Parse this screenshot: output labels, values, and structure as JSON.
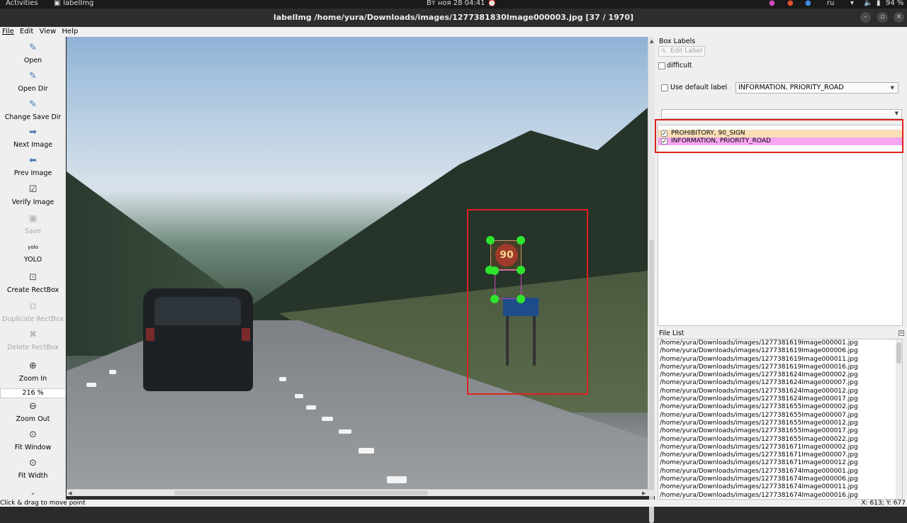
{
  "topbar": {
    "activities": "Activities",
    "app_name": "labelImg",
    "clock": "Вт ноя 28  04:41",
    "lang": "ru",
    "battery": "94 %"
  },
  "window": {
    "title": "labelImg /home/yura/Downloads/images/1277381830Image000003.jpg [37 / 1970]",
    "minimize": "–",
    "maximize": "▫",
    "close": "×"
  },
  "menu": [
    "File",
    "Edit",
    "View",
    "Help"
  ],
  "toolbar": {
    "open": "Open",
    "open_dir": "Open Dir",
    "change_save_dir": "Change Save Dir",
    "next_image": "Next Image",
    "prev_image": "Prev Image",
    "verify_image": "Verify Image",
    "save": "Save",
    "yolo_icon": "yolo",
    "yolo": "YOLO",
    "create_rectbox": "Create RectBox",
    "duplicate_rectbox": "Duplicate RectBox",
    "delete_rectbox": "Delete RectBox",
    "zoom_in": "Zoom In",
    "zoom_value": "216 %",
    "zoom_out": "Zoom Out",
    "fit_window": "Fit Window",
    "fit_width": "Fit Width"
  },
  "canvas": {
    "speed_sign_text": "90"
  },
  "right_panel": {
    "box_labels_title": "Box Labels",
    "edit_label": "Edit Label",
    "difficult": "difficult",
    "use_default_label": "Use default label",
    "default_label_value": "INFORMATION, PRIORITY_ROAD",
    "labels": [
      {
        "text": "PROHIBITORY, 90_SIGN",
        "checked": "✓",
        "color": "#f9deb6"
      },
      {
        "text": "INFORMATION, PRIORITY_ROAD",
        "checked": "✓",
        "color": "#f7a6f2"
      }
    ],
    "file_list_title": "File List",
    "files": [
      "/home/yura/Downloads/images/1277381619Image000001.jpg",
      "/home/yura/Downloads/images/1277381619Image000006.jpg",
      "/home/yura/Downloads/images/1277381619Image000011.jpg",
      "/home/yura/Downloads/images/1277381619Image000016.jpg",
      "/home/yura/Downloads/images/1277381624Image000002.jpg",
      "/home/yura/Downloads/images/1277381624Image000007.jpg",
      "/home/yura/Downloads/images/1277381624Image000012.jpg",
      "/home/yura/Downloads/images/1277381624Image000017.jpg",
      "/home/yura/Downloads/images/1277381655Image000002.jpg",
      "/home/yura/Downloads/images/1277381655Image000007.jpg",
      "/home/yura/Downloads/images/1277381655Image000012.jpg",
      "/home/yura/Downloads/images/1277381655Image000017.jpg",
      "/home/yura/Downloads/images/1277381655Image000022.jpg",
      "/home/yura/Downloads/images/1277381671Image000002.jpg",
      "/home/yura/Downloads/images/1277381671Image000007.jpg",
      "/home/yura/Downloads/images/1277381671Image000012.jpg",
      "/home/yura/Downloads/images/1277381674Image000001.jpg",
      "/home/yura/Downloads/images/1277381674Image000006.jpg",
      "/home/yura/Downloads/images/1277381674Image000011.jpg",
      "/home/yura/Downloads/images/1277381674Image000016.jpg"
    ]
  },
  "status": {
    "message": "Click & drag to move point",
    "coords": "X: 613; Y: 677"
  },
  "colors": {
    "highlight_red": "#e02020",
    "handle_green": "#2ee52e"
  }
}
